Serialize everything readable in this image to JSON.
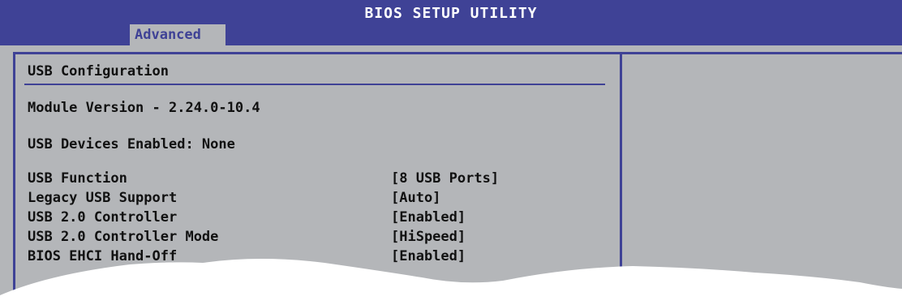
{
  "header": {
    "title": "BIOS SETUP UTILITY",
    "active_tab": "Advanced"
  },
  "panel": {
    "section_title": "USB Configuration",
    "module_version": "Module Version - 2.24.0-10.4",
    "devices_enabled": "USB Devices Enabled: None",
    "settings": [
      {
        "label": "USB Function",
        "value": "[8 USB Ports]"
      },
      {
        "label": "Legacy USB Support",
        "value": "[Auto]"
      },
      {
        "label": "USB 2.0 Controller",
        "value": "[Enabled]"
      },
      {
        "label": "USB 2.0 Controller Mode",
        "value": "[HiSpeed]"
      },
      {
        "label": "BIOS EHCI Hand-Off",
        "value": "[Enabled]"
      }
    ]
  },
  "colors": {
    "title_bar": "#3f4296",
    "panel_bg": "#b4b6b9",
    "text": "#111111",
    "frame": "#3f4296"
  }
}
